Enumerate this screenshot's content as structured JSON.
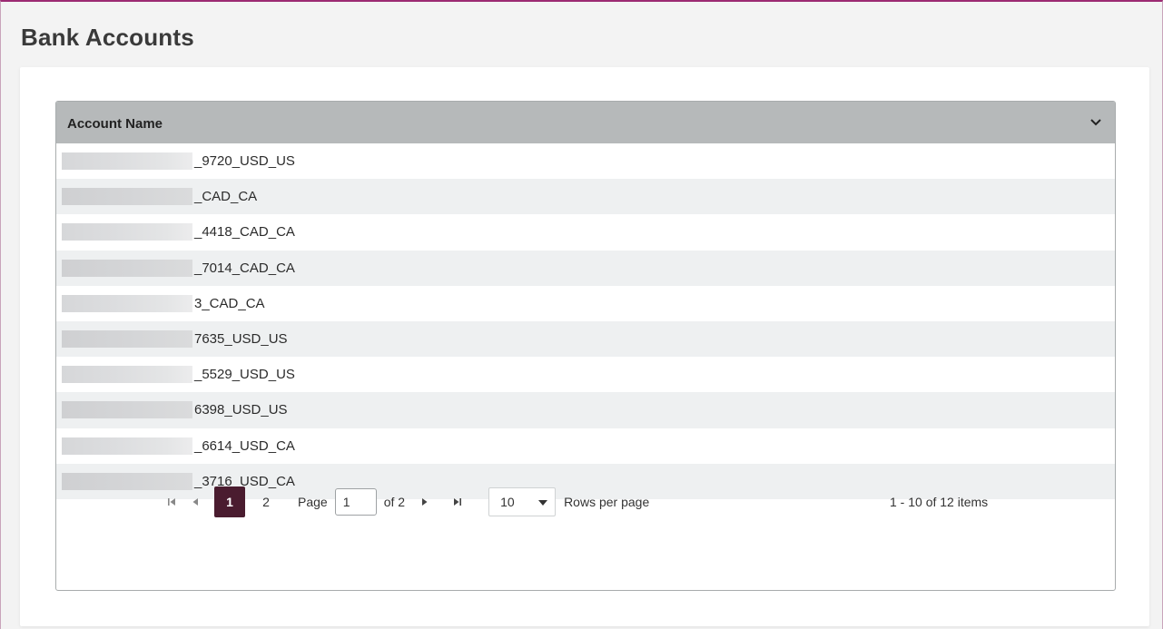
{
  "page": {
    "title": "Bank Accounts"
  },
  "grid": {
    "column_header": "Account Name",
    "expand_icon": "chevron-down-icon",
    "rows": [
      {
        "suffix": "_9720_USD_US",
        "redacted": true
      },
      {
        "suffix": "_CAD_CA",
        "redacted": true
      },
      {
        "suffix": "_4418_CAD_CA",
        "redacted": true
      },
      {
        "suffix": "_7014_CAD_CA",
        "redacted": true
      },
      {
        "suffix": "3_CAD_CA",
        "redacted": true
      },
      {
        "suffix": "7635_USD_US",
        "redacted": true
      },
      {
        "suffix": "_5529_USD_US",
        "redacted": true
      },
      {
        "suffix": "6398_USD_US",
        "redacted": true
      },
      {
        "suffix": "_6614_USD_CA",
        "redacted": true
      },
      {
        "suffix": "_3716_USD_CA",
        "redacted": true
      }
    ]
  },
  "pager": {
    "first_icon": "first-page-icon",
    "prev_icon": "previous-page-icon",
    "next_icon": "next-page-icon",
    "last_icon": "last-page-icon",
    "pages": [
      "1",
      "2"
    ],
    "active_page": "1",
    "page_label": "Page",
    "page_input_value": "1",
    "of_label": "of 2",
    "rows_per_page_value": "10",
    "rows_per_page_label": "Rows per page",
    "item_count": "1 - 10 of 12 items"
  },
  "colors": {
    "accent_border": "#9c2a72",
    "header_bg": "#b6b9ba",
    "active_page_bg": "#4a1c2f",
    "row_alt_bg": "#eef0f1"
  }
}
